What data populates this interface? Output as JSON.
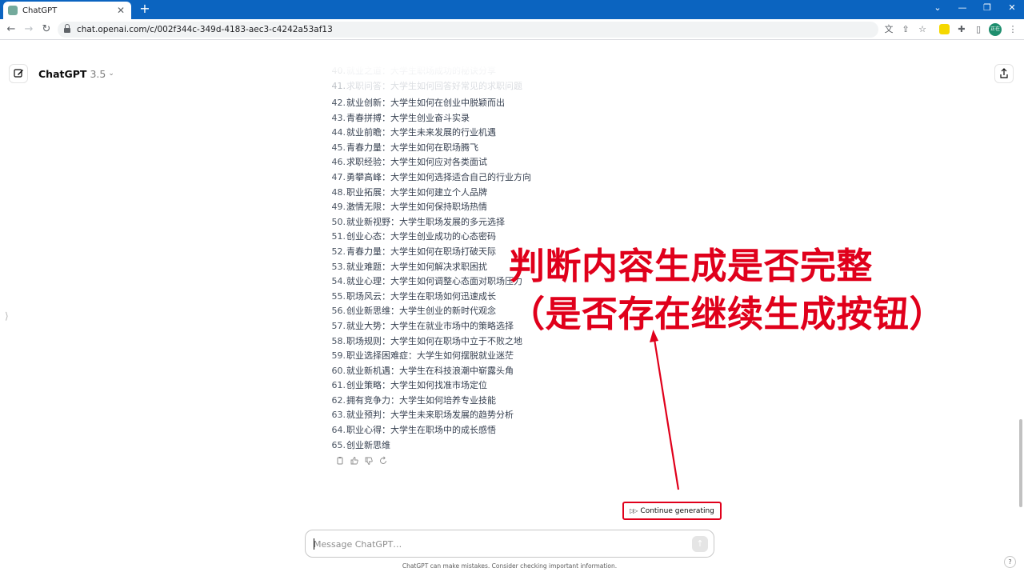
{
  "browser": {
    "tab_title": "ChatGPT",
    "tab_close": "✕",
    "new_tab": "+",
    "url": "chat.openai.com/c/002f344c-349d-4183-aec3-c4242a53af13",
    "extension_badge": "‚„",
    "profile_initials": "正在"
  },
  "header": {
    "model_name": "ChatGPT",
    "model_version": "3.5"
  },
  "faded_lines": [
    {
      "num": "40.",
      "text": "就业之道：大学生职场成功的秘诀分享"
    },
    {
      "num": "41.",
      "text": "求职问答：大学生如何回答好常见的求职问题"
    }
  ],
  "lines": [
    {
      "num": "42.",
      "text": "就业创新：大学生如何在创业中脱颖而出"
    },
    {
      "num": "43.",
      "text": "青春拼搏：大学生创业奋斗实录"
    },
    {
      "num": "44.",
      "text": "就业前瞻：大学生未来发展的行业机遇"
    },
    {
      "num": "45.",
      "text": "青春力量：大学生如何在职场腾飞"
    },
    {
      "num": "46.",
      "text": "求职经验：大学生如何应对各类面试"
    },
    {
      "num": "47.",
      "text": "勇攀高峰：大学生如何选择适合自己的行业方向"
    },
    {
      "num": "48.",
      "text": "职业拓展：大学生如何建立个人品牌"
    },
    {
      "num": "49.",
      "text": "激情无限：大学生如何保持职场热情"
    },
    {
      "num": "50.",
      "text": "就业新视野：大学生职场发展的多元选择"
    },
    {
      "num": "51.",
      "text": "创业心态：大学生创业成功的心态密码"
    },
    {
      "num": "52.",
      "text": "青春力量：大学生如何在职场打破天际"
    },
    {
      "num": "53.",
      "text": "就业难题：大学生如何解决求职困扰"
    },
    {
      "num": "54.",
      "text": "就业心理：大学生如何调整心态面对职场压力"
    },
    {
      "num": "55.",
      "text": "职场风云：大学生在职场如何迅速成长"
    },
    {
      "num": "56.",
      "text": "创业新思维：大学生创业的新时代观念"
    },
    {
      "num": "57.",
      "text": "就业大势：大学生在就业市场中的策略选择"
    },
    {
      "num": "58.",
      "text": "职场规则：大学生如何在职场中立于不败之地"
    },
    {
      "num": "59.",
      "text": "职业选择困难症：大学生如何摆脱就业迷茫"
    },
    {
      "num": "60.",
      "text": "就业新机遇：大学生在科技浪潮中崭露头角"
    },
    {
      "num": "61.",
      "text": "创业策略：大学生如何找准市场定位"
    },
    {
      "num": "62.",
      "text": "拥有竞争力：大学生如何培养专业技能"
    },
    {
      "num": "63.",
      "text": "就业预判：大学生未来职场发展的趋势分析"
    },
    {
      "num": "64.",
      "text": "职业心得：大学生在职场中的成长感悟"
    },
    {
      "num": "65.",
      "text": "创业新思维"
    }
  ],
  "continue": {
    "label": "Continue generating"
  },
  "composer": {
    "placeholder": "Message ChatGPT…"
  },
  "footer": {
    "disclaimer": "ChatGPT can make mistakes. Consider checking important information.",
    "help": "?"
  },
  "annotation": {
    "line1": "判断内容生成是否完整",
    "line2": "（是否存在继续生成按钮）",
    "color": "#e0001b"
  },
  "colors": {
    "tabbar": "#0b64c0",
    "accent_red": "#e0001b"
  }
}
